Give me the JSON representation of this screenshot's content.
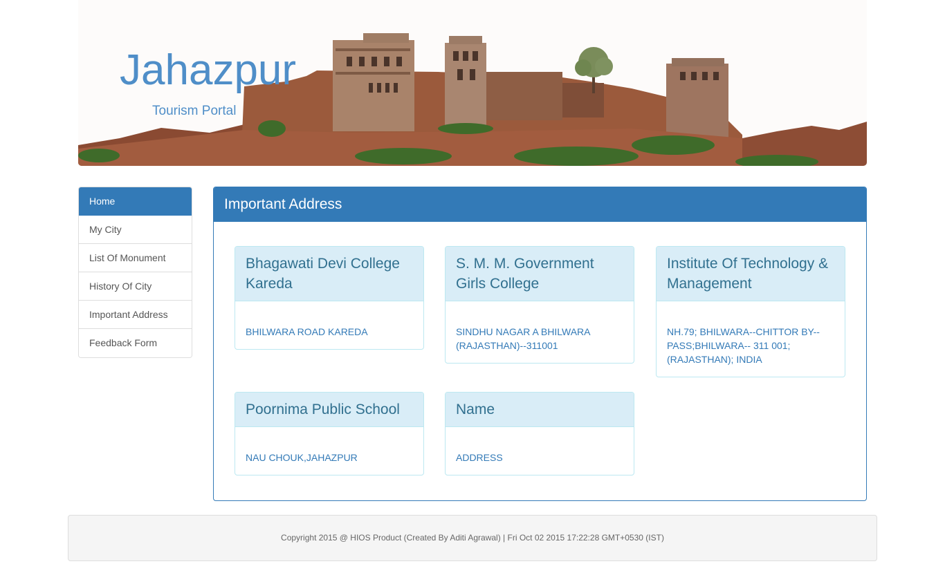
{
  "banner": {
    "title": "Jahazpur",
    "subtitle": "Tourism Portal",
    "image_icon": "fort-illustration"
  },
  "sidebar": {
    "items": [
      {
        "label": "Home",
        "active": true
      },
      {
        "label": "My City",
        "active": false
      },
      {
        "label": "List Of Monument",
        "active": false
      },
      {
        "label": "History Of City",
        "active": false
      },
      {
        "label": "Important Address",
        "active": false
      },
      {
        "label": "Feedback Form",
        "active": false
      }
    ]
  },
  "main": {
    "heading": "Important Address",
    "cards": [
      {
        "name": "Bhagawati Devi College Kareda",
        "address": "BHILWARA ROAD KAREDA"
      },
      {
        "name": "S. M. M. Government Girls College",
        "address": "SINDHU NAGAR A BHILWARA (RAJASTHAN)--311001"
      },
      {
        "name": "Institute Of Technology & Management",
        "address": "NH.79; BHILWARA--CHITTOR BY--PASS;BHILWARA-- 311 001; (RAJASTHAN); INDIA"
      },
      {
        "name": "Poornima Public School",
        "address": "NAU CHOUK,JAHAZPUR"
      },
      {
        "name": "Name",
        "address": "ADDRESS"
      }
    ]
  },
  "footer": {
    "text": "Copyright 2015 @ HIOS Product (Created By Aditi Agrawal) | Fri Oct 02 2015 17:22:28 GMT+0530 (IST)"
  },
  "colors": {
    "primary": "#337ab7",
    "title_blue": "#4f8ec8",
    "card_heading_bg": "#d9edf7",
    "card_heading_text": "#31708f",
    "card_border": "#bce8f1"
  }
}
